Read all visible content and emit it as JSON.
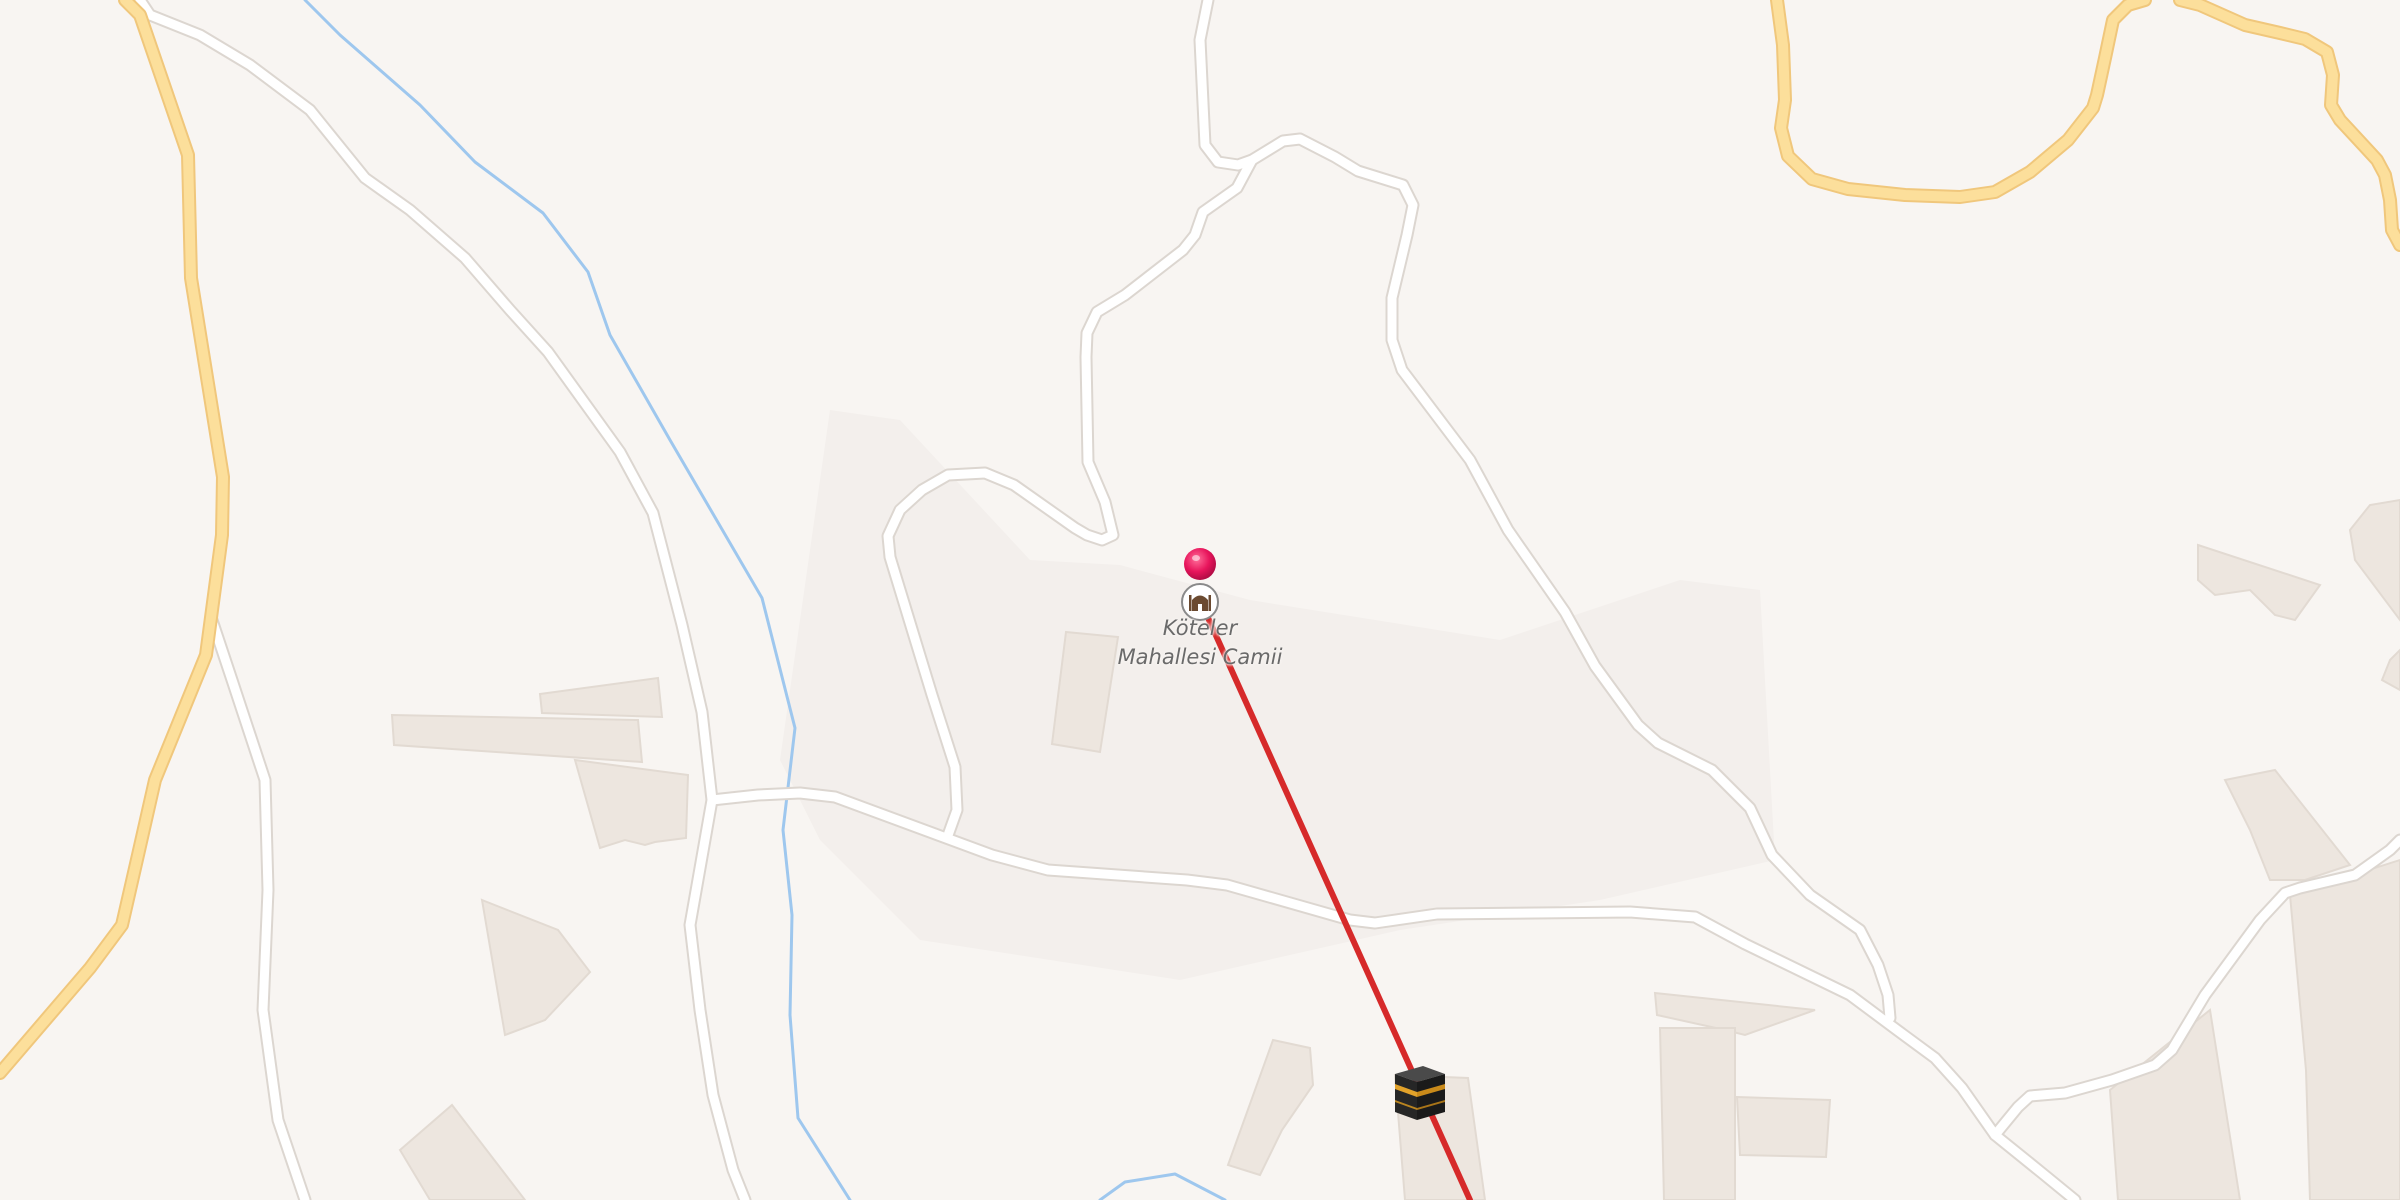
{
  "map": {
    "poi": {
      "name_line1": "Köteler",
      "name_line2": "Mahallesi Camii",
      "icon": "mosque-icon"
    },
    "selected_marker": {
      "icon": "map-pin-icon",
      "color": "#e8155c"
    },
    "destination": {
      "icon": "kaaba-icon"
    },
    "qibla_line": {
      "color": "#d62a2a"
    },
    "colors": {
      "background": "#f8f5f2",
      "major_road": "#fcdf9b",
      "minor_road": "#ffffff",
      "water": "#9ec7ee",
      "building": "#ede5dd"
    }
  }
}
